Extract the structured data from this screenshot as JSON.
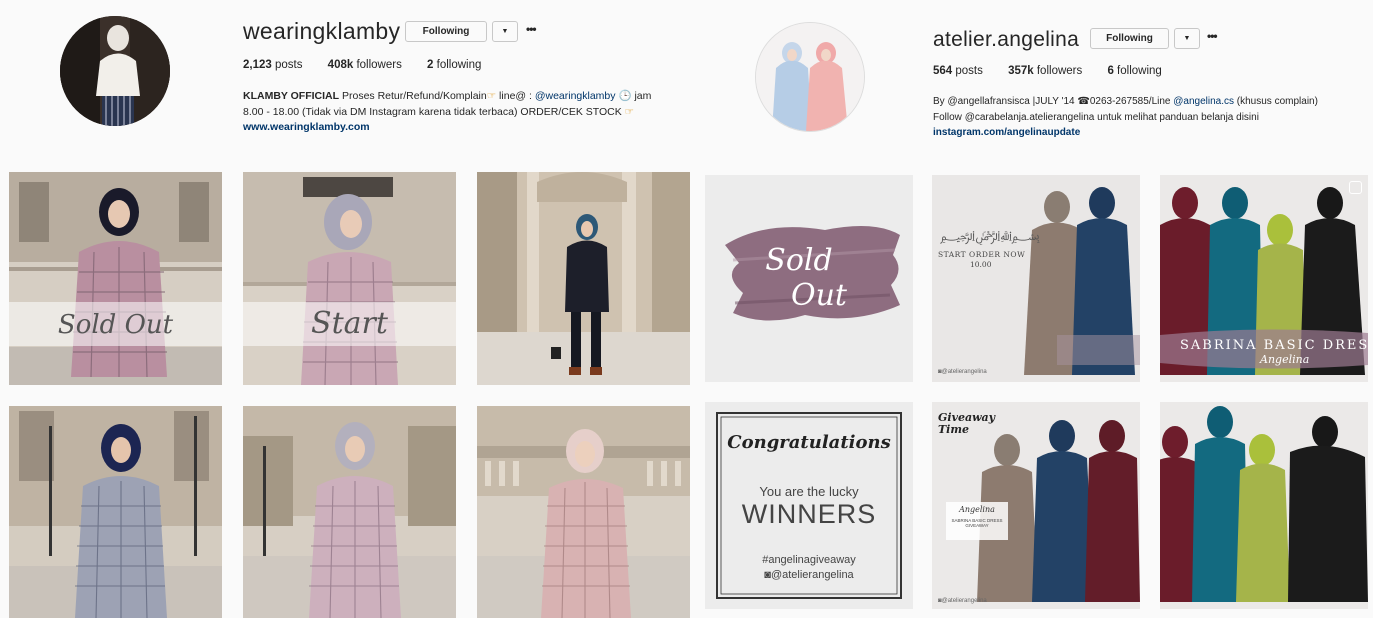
{
  "left_profile": {
    "username": "wearingklamby",
    "follow_label": "Following",
    "posts_count": "2,123",
    "posts_label": " posts",
    "followers_count": "408k",
    "followers_label": " followers",
    "following_count": "2",
    "following_label": " following",
    "bio_name": "KLAMBY OFFICIAL",
    "bio_text_1": " Proses Retur/Refund/Komplain",
    "bio_text_2": " line@ : ",
    "bio_mention": "@wearingklamby",
    "bio_text_3": " jam",
    "bio_text_4": "8.00 - 18.00 (Tidak via DM Instagram karena tidak terbaca) ORDER/CEK STOCK",
    "bio_link": "www.wearingklamby.com"
  },
  "right_profile": {
    "username": "atelier.angelina",
    "follow_label": "Following",
    "posts_count": "564",
    "posts_label": " posts",
    "followers_count": "357k",
    "followers_label": " followers",
    "following_count": "6",
    "following_label": " following",
    "bio_line_1a": "By ",
    "bio_mention_1": "@angellafransisca",
    "bio_line_1b": " |JULY '14 ",
    "bio_line_1c": "0263-267585/Line ",
    "bio_mention_2": "@angelina.cs",
    "bio_line_1d": " (khusus complain)",
    "bio_line_2a": "Follow ",
    "bio_mention_3": "@carabelanja.atelierangelina",
    "bio_line_2b": " untuk melihat panduan belanja disini",
    "bio_link": "instagram.com/angelinaupdate"
  },
  "posts": {
    "sold_out_1": "Sold Out",
    "start": "Start",
    "sold_out_2a": "Sold",
    "sold_out_2b": "Out",
    "start_order": "START ORDER NOW",
    "start_time": "10.00",
    "sabrina": "SABRINA BASIC DRESS",
    "angelina_script": "Angelina",
    "watermark": "@atelierangelina",
    "congrats": "Congratulations",
    "lucky": "You are the lucky",
    "winners": "WINNERS",
    "hashtag": "#angelinagiveaway",
    "handle": "@atelierangelina",
    "giveaway_time": "Giveaway Time",
    "giveaway_brand": "Angelina",
    "giveaway_sub": "SABRINA BASIC DRESS GIVEAWAY"
  },
  "colors": {
    "link": "#003569",
    "border": "#c8c8c8",
    "background": "#fafafa"
  }
}
